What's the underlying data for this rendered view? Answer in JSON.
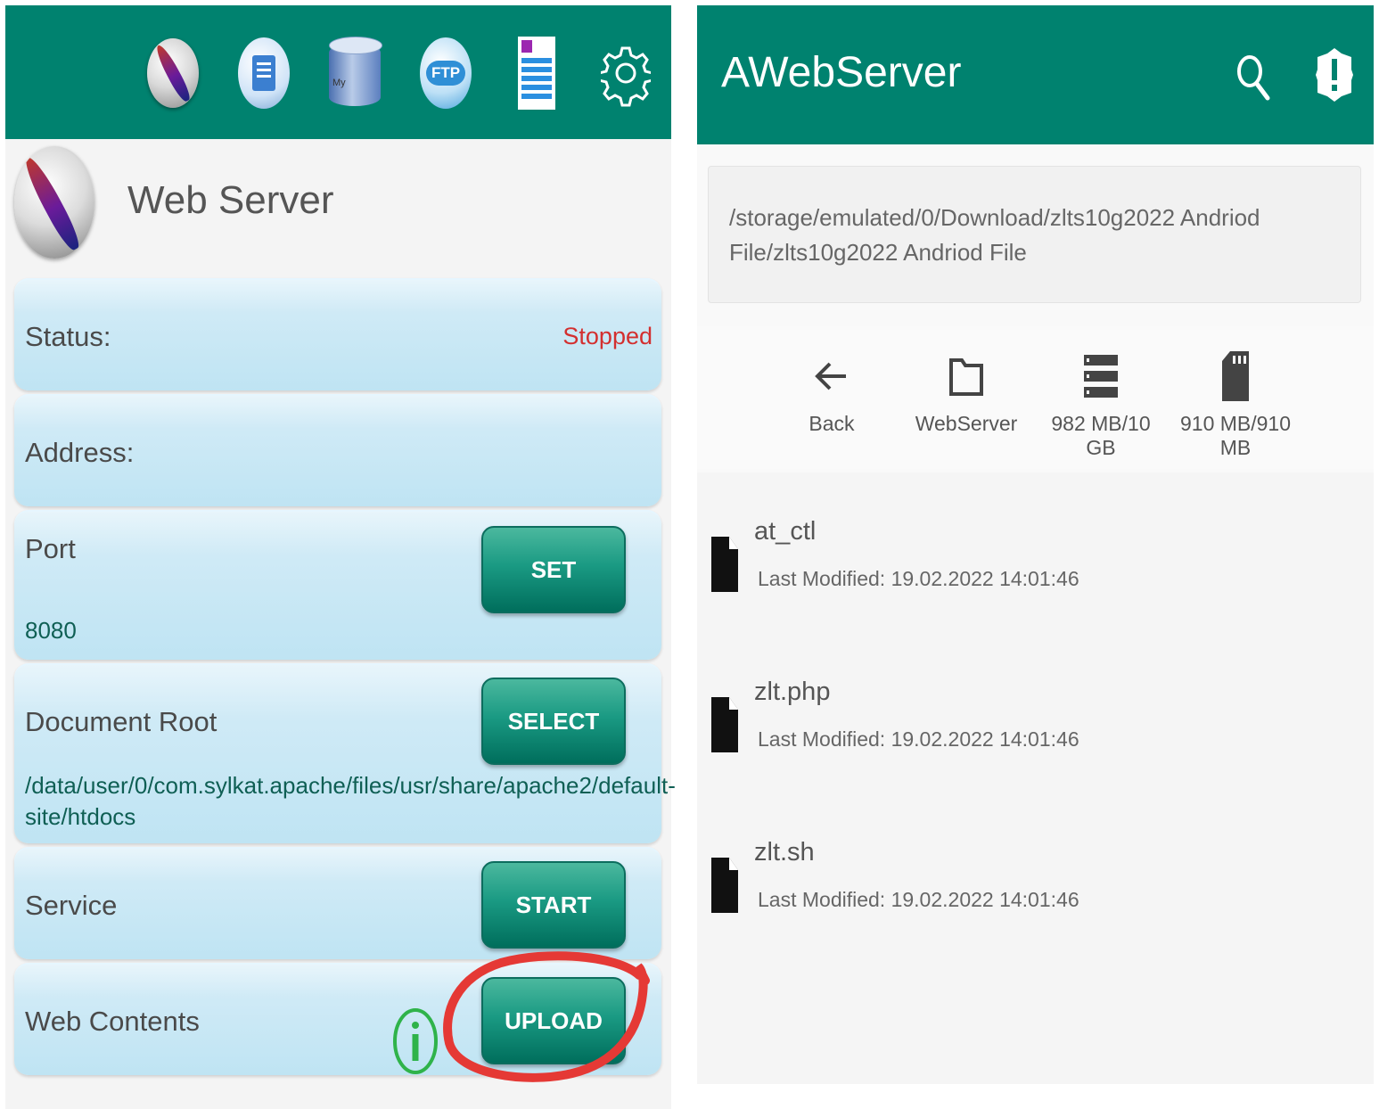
{
  "left_app": {
    "toolbar_icons": [
      "apache-feather-icon",
      "log-file-icon",
      "mysql-icon",
      "ftp-icon",
      "document-icon",
      "gear-icon"
    ],
    "title": "Web Server",
    "status_label": "Status:",
    "status_value": "Stopped",
    "address_label": "Address:",
    "port_label": "Port",
    "port_value": "8080",
    "port_button": "SET",
    "docroot_label": "Document Root",
    "docroot_button": "SELECT",
    "docroot_value": "/data/user/0/com.sylkat.apache/files/usr/share/apache2/default-site/htdocs",
    "service_label": "Service",
    "service_button": "START",
    "contents_label": "Web Contents",
    "contents_button": "UPLOAD",
    "colors": {
      "toolbar": "#00826f",
      "stopped": "#d32f2f",
      "annotation": "#e53935"
    }
  },
  "right_app": {
    "title": "AWebServer",
    "path": "/storage/emulated/0/Download/zlts10g2022 Andriod File/zlts10g2022 Andriod File",
    "nav": [
      {
        "label": "Back",
        "icon": "arrow-back-icon"
      },
      {
        "label": "WebServer",
        "icon": "folder-icon"
      },
      {
        "label": "982 MB/10 GB",
        "icon": "storage-icon"
      },
      {
        "label": "910 MB/910 MB",
        "icon": "sd-card-icon"
      }
    ],
    "files": [
      {
        "name": "at_ctl",
        "modified": "Last Modified: 19.02.2022 14:01:46"
      },
      {
        "name": "zlt.php",
        "modified": "Last Modified: 19.02.2022 14:01:46"
      },
      {
        "name": "zlt.sh",
        "modified": "Last Modified: 19.02.2022 14:01:46"
      }
    ]
  }
}
